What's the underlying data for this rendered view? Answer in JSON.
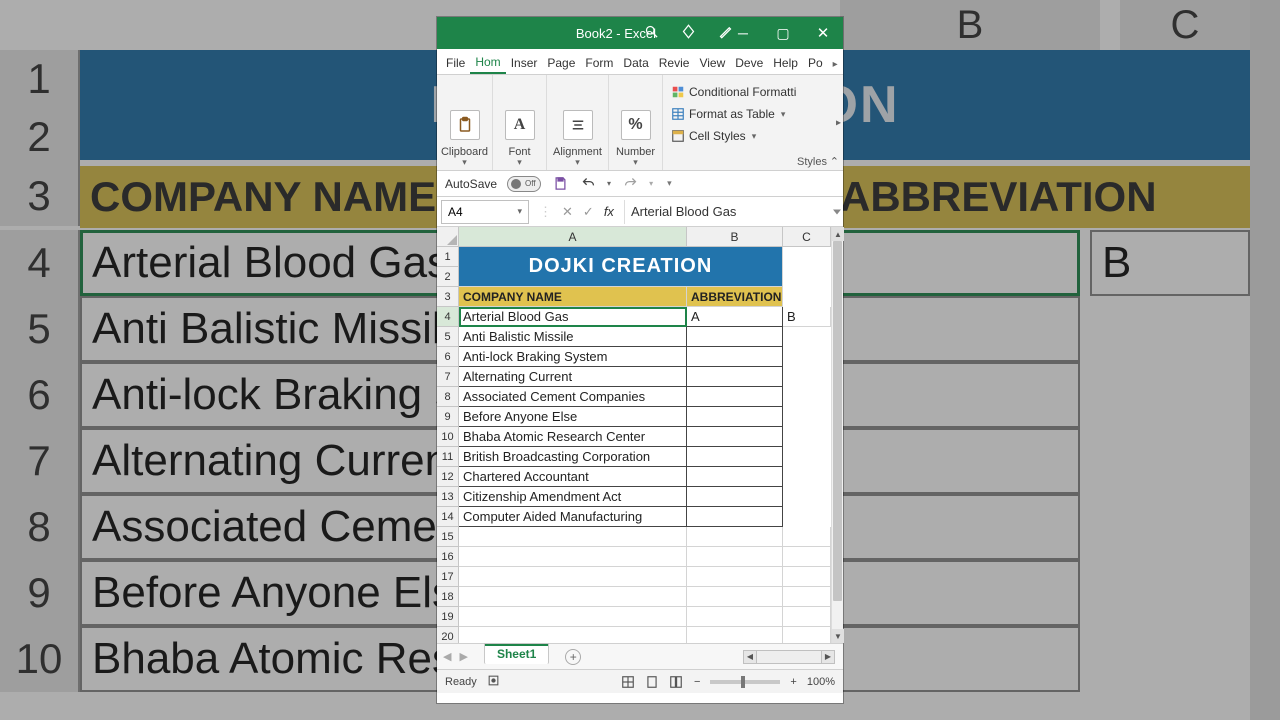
{
  "titlebar": {
    "title": "Book2 - Excel"
  },
  "ribbon": {
    "tabs": [
      "File",
      "Hom",
      "Inser",
      "Page",
      "Form",
      "Data",
      "Revie",
      "View",
      "Deve",
      "Help",
      "Po"
    ],
    "groups": {
      "clipboard": "Clipboard",
      "font": "Font",
      "alignment": "Alignment",
      "number": "Number"
    },
    "styles": {
      "cond": "Conditional Formatti",
      "table": "Format as Table",
      "cell": "Cell Styles",
      "label": "Styles"
    }
  },
  "qat": {
    "autosave": "AutoSave",
    "autosave_state": "Off"
  },
  "namebox": "A4",
  "formula": "Arterial Blood Gas",
  "columns": [
    "A",
    "B",
    "C"
  ],
  "title_cell": "DOJKI CREATION",
  "headers": {
    "col1": "COMPANY NAME",
    "col2": "ABBREVIATION"
  },
  "rows": [
    {
      "n": 4,
      "name": "Arterial Blood Gas",
      "abbr": "A"
    },
    {
      "n": 5,
      "name": "Anti Balistic Missile",
      "abbr": ""
    },
    {
      "n": 6,
      "name": "Anti-lock Braking System",
      "abbr": ""
    },
    {
      "n": 7,
      "name": "Alternating Current",
      "abbr": ""
    },
    {
      "n": 8,
      "name": "Associated Cement Companies",
      "abbr": ""
    },
    {
      "n": 9,
      "name": "Before Anyone Else",
      "abbr": ""
    },
    {
      "n": 10,
      "name": "Bhaba Atomic Research Center",
      "abbr": ""
    },
    {
      "n": 11,
      "name": "British Broadcasting Corporation",
      "abbr": ""
    },
    {
      "n": 12,
      "name": "Chartered Accountant",
      "abbr": ""
    },
    {
      "n": 13,
      "name": "Citizenship Amendment Act",
      "abbr": ""
    },
    {
      "n": 14,
      "name": "Computer Aided Manufacturing",
      "abbr": ""
    }
  ],
  "overflow_B": "B",
  "sheet_tab": "Sheet1",
  "status": {
    "ready": "Ready",
    "zoom": "100%"
  },
  "bg": {
    "col_B": "B",
    "col_C": "C",
    "title": "DOJKI CREATION",
    "hdr1": "COMPANY NAME",
    "hdr2": "ABBREVIATION",
    "rows": [
      {
        "n": 4,
        "t": "Arterial Blood Gas",
        "b": "B"
      },
      {
        "n": 5,
        "t": "Anti Balistic Missile"
      },
      {
        "n": 6,
        "t": "Anti-lock Braking System"
      },
      {
        "n": 7,
        "t": "Alternating Current"
      },
      {
        "n": 8,
        "t": "Associated Cement Companies"
      },
      {
        "n": 9,
        "t": "Before Anyone Else"
      },
      {
        "n": 10,
        "t": "Bhaba Atomic Research Center"
      }
    ]
  }
}
